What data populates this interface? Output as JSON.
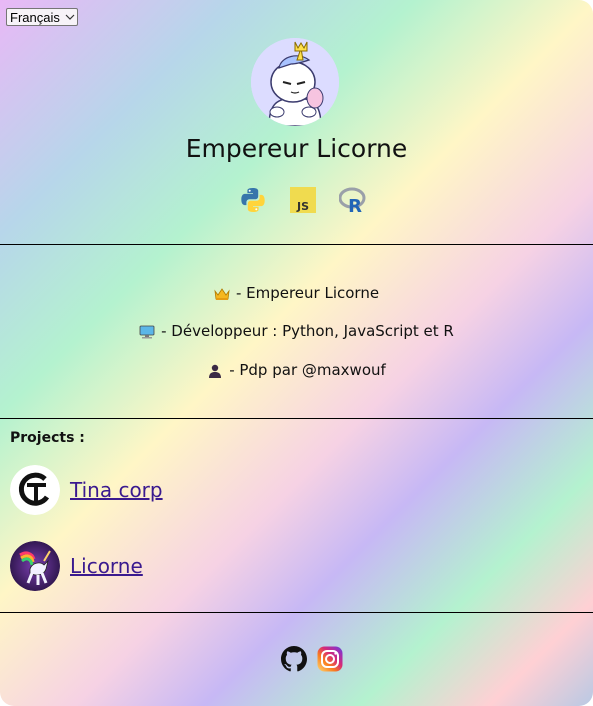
{
  "language_select": {
    "value": "Français"
  },
  "profile": {
    "name": "Empereur Licorne"
  },
  "skills_icons": [
    "python-icon",
    "javascript-icon",
    "r-icon"
  ],
  "info": [
    {
      "icon": "crown-icon",
      "text": "- Empereur Licorne"
    },
    {
      "icon": "computer-icon",
      "text": "- Développeur : Python, JavaScript et R"
    },
    {
      "icon": "person-icon",
      "text": "- Pdp par @maxwouf"
    }
  ],
  "projects": {
    "title": "Projects :",
    "items": [
      {
        "label": "Tina corp",
        "icon": "tina-corp-logo"
      },
      {
        "label": "Licorne",
        "icon": "licorne-logo"
      }
    ]
  },
  "social": [
    "github-icon",
    "instagram-icon"
  ],
  "colors": {
    "link": "#3a1a8f",
    "rule": "#000000"
  }
}
